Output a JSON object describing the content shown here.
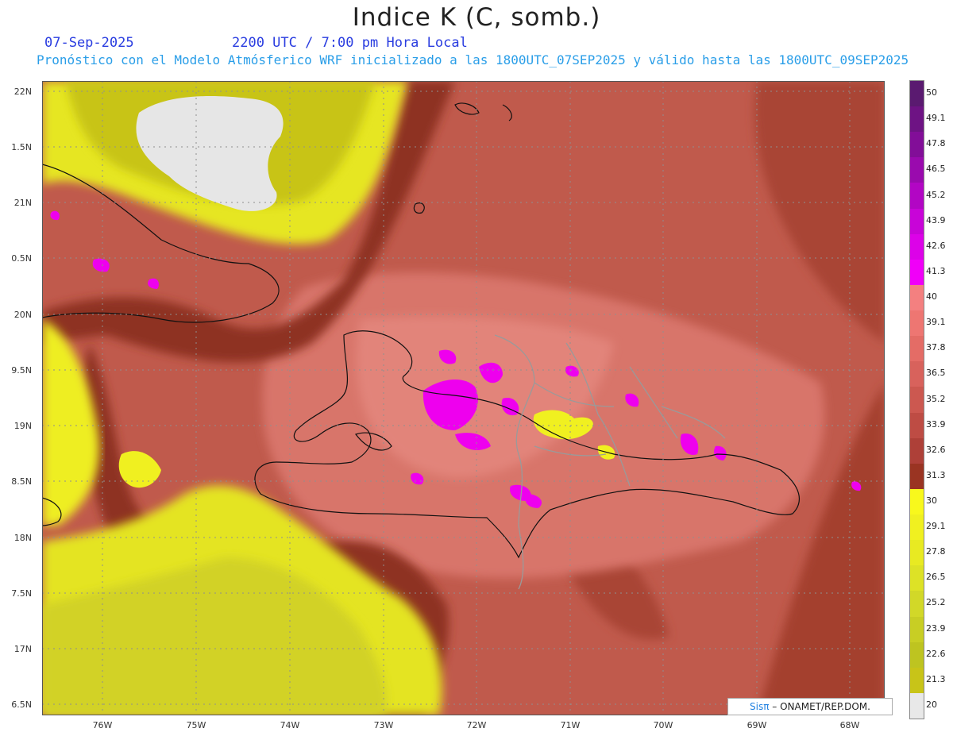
{
  "title": "Indice K (C, somb.)",
  "date": "07-Sep-2025",
  "time": "2200 UTC / 7:00 pm Hora Local",
  "forecast": "Pronóstico con el Modelo Atmósferico WRF inicializado a las 1800UTC_07SEP2025 y válido hasta las  1800UTC_09SEP2025",
  "lat_labels": [
    "22N",
    "1.5N",
    "21N",
    "0.5N",
    "20N",
    "9.5N",
    "19N",
    "8.5N",
    "18N",
    "7.5N",
    "17N",
    "6.5N"
  ],
  "lon_labels": [
    "76W",
    "75W",
    "74W",
    "73W",
    "72W",
    "71W",
    "70W",
    "69W",
    "68W"
  ],
  "colorbar": {
    "labels": [
      "50",
      "49.1",
      "47.8",
      "46.5",
      "45.2",
      "43.9",
      "42.6",
      "41.3",
      "40",
      "39.1",
      "37.8",
      "36.5",
      "35.2",
      "33.9",
      "32.6",
      "31.3",
      "30",
      "29.1",
      "27.8",
      "26.5",
      "25.2",
      "23.9",
      "22.6",
      "21.3",
      "20"
    ],
    "colors": [
      "#5a1a70",
      "#6e1384",
      "#820e98",
      "#9a0aae",
      "#b206c4",
      "#c804d8",
      "#dc02e8",
      "#f000f8",
      "#f48080",
      "#ee7672",
      "#e46c66",
      "#d8625c",
      "#cc5850",
      "#be4c44",
      "#ae4038",
      "#9a3422",
      "#f8f81c",
      "#f0f020",
      "#e8ea22",
      "#dde226",
      "#d2d828",
      "#c8ce24",
      "#bec420",
      "#c8c418",
      "#e8e8e8"
    ]
  },
  "credit": {
    "brand": "Sisπ",
    "text": "– ONAMET/REP.DOM."
  }
}
